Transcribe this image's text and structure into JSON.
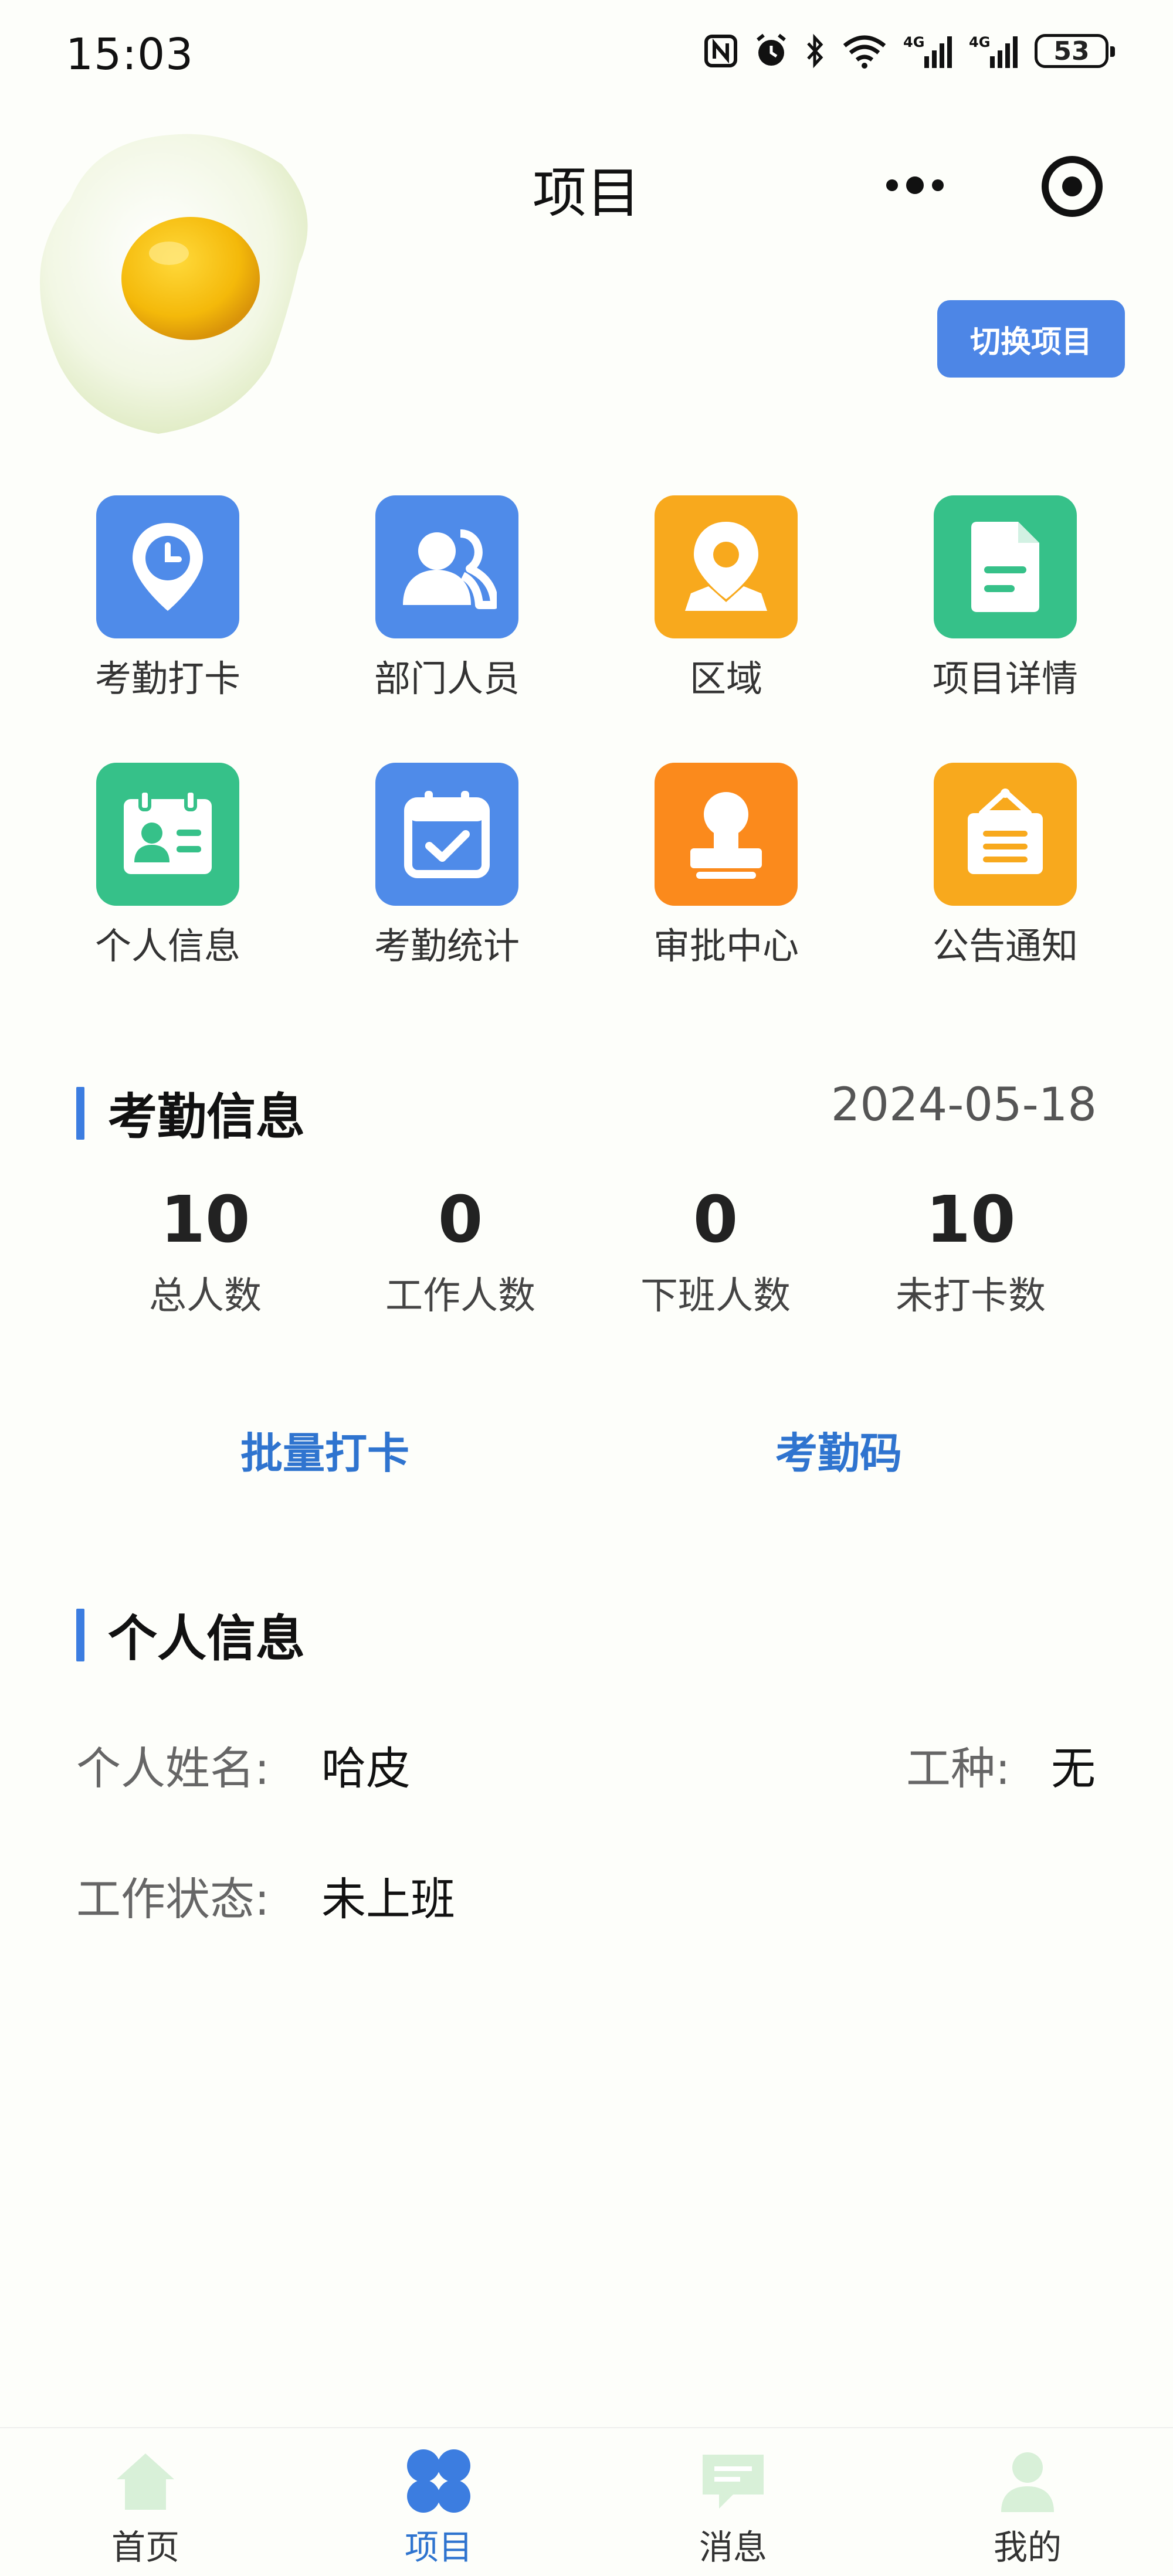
{
  "status_bar": {
    "time": "15:03",
    "battery": "53",
    "network_1": "4G",
    "network_2": "4G"
  },
  "header": {
    "title": "项目"
  },
  "switch_button": "切换项目",
  "menu": [
    {
      "label": "考勤打卡",
      "icon": "location-clock-icon",
      "color": "#4f8be9"
    },
    {
      "label": "部门人员",
      "icon": "people-icon",
      "color": "#4f8be9"
    },
    {
      "label": "区域",
      "icon": "map-pin-icon",
      "color": "#f8a91d"
    },
    {
      "label": "项目详情",
      "icon": "document-icon",
      "color": "#36c189"
    },
    {
      "label": "个人信息",
      "icon": "id-card-icon",
      "color": "#36c189"
    },
    {
      "label": "考勤统计",
      "icon": "calendar-check-icon",
      "color": "#4f8be9"
    },
    {
      "label": "审批中心",
      "icon": "stamp-icon",
      "color": "#fb8a1c"
    },
    {
      "label": "公告通知",
      "icon": "notice-board-icon",
      "color": "#f8a91d"
    }
  ],
  "attendance": {
    "title": "考勤信息",
    "date": "2024-05-18",
    "stats": [
      {
        "value": "10",
        "label": "总人数"
      },
      {
        "value": "0",
        "label": "工作人数"
      },
      {
        "value": "0",
        "label": "下班人数"
      },
      {
        "value": "10",
        "label": "未打卡数"
      }
    ],
    "batch_punch": "批量打卡",
    "attendance_code": "考勤码"
  },
  "personal": {
    "title": "个人信息",
    "name_label": "个人姓名:",
    "name_value": "哈皮",
    "job_label": "工种:",
    "job_value": "无",
    "status_label": "工作状态:",
    "status_value": "未上班"
  },
  "tabs": [
    {
      "label": "首页",
      "icon": "home-icon"
    },
    {
      "label": "项目",
      "icon": "clover-icon"
    },
    {
      "label": "消息",
      "icon": "message-icon"
    },
    {
      "label": "我的",
      "icon": "user-icon"
    }
  ],
  "colors": {
    "accent": "#4d86e6",
    "link": "#2f74cf",
    "section_bar": "#3c7de0"
  }
}
